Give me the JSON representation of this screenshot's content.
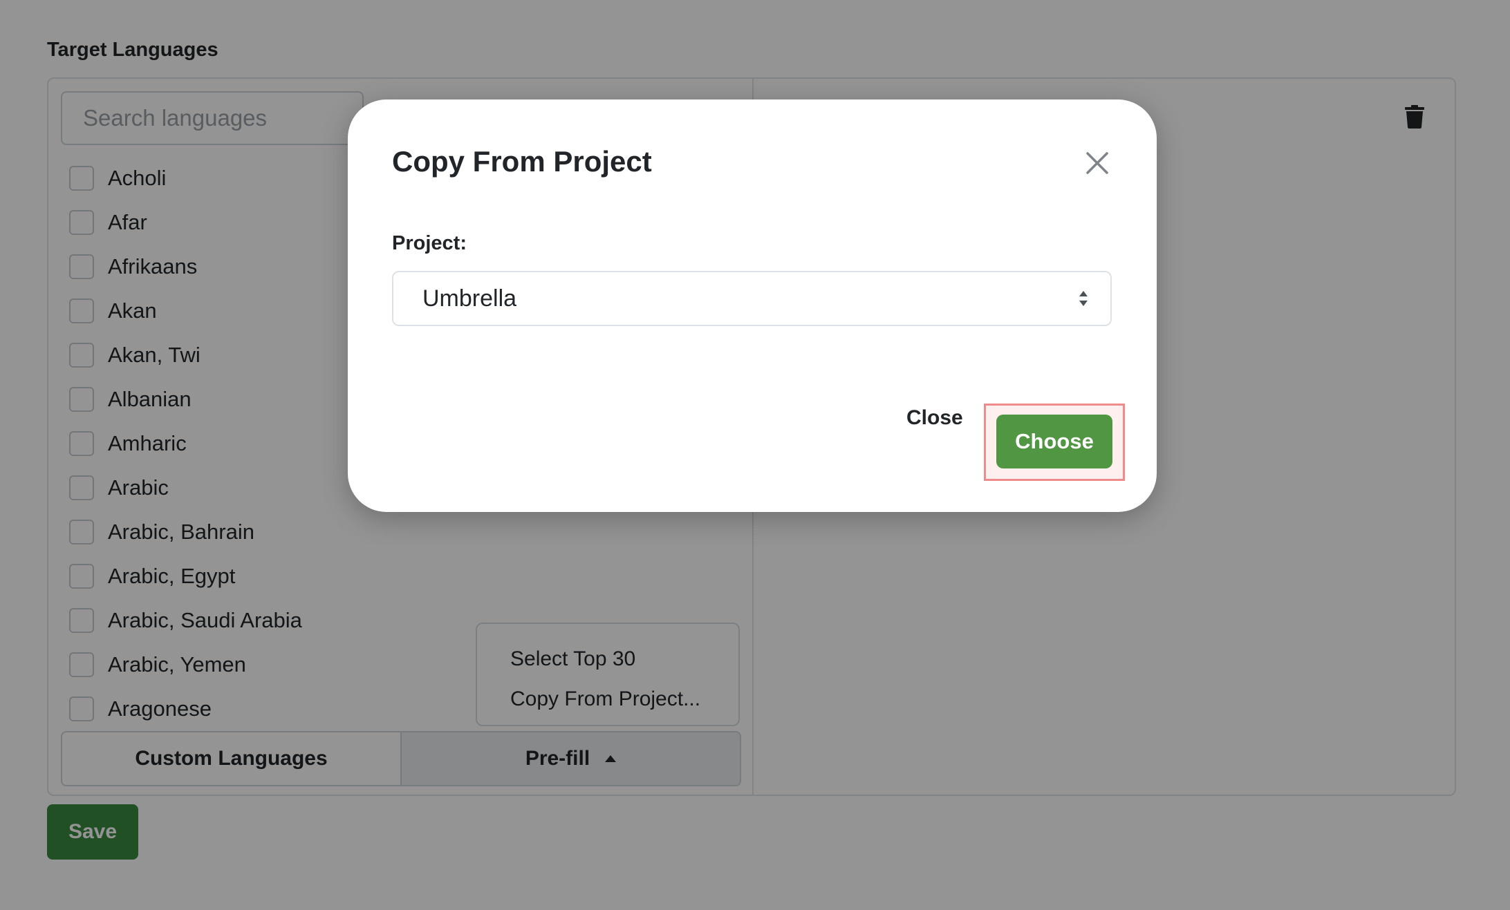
{
  "section": {
    "label": "Target Languages"
  },
  "search": {
    "placeholder": "Search languages",
    "value": ""
  },
  "languages": [
    {
      "label": "Acholi"
    },
    {
      "label": "Afar"
    },
    {
      "label": "Afrikaans"
    },
    {
      "label": "Akan"
    },
    {
      "label": "Akan, Twi"
    },
    {
      "label": "Albanian"
    },
    {
      "label": "Amharic"
    },
    {
      "label": "Arabic"
    },
    {
      "label": "Arabic, Bahrain"
    },
    {
      "label": "Arabic, Egypt"
    },
    {
      "label": "Arabic, Saudi Arabia"
    },
    {
      "label": "Arabic, Yemen"
    },
    {
      "label": "Aragonese"
    }
  ],
  "prefill_menu": {
    "items": [
      {
        "label": "Select Top 30"
      },
      {
        "label": "Copy From Project..."
      }
    ]
  },
  "bottom_buttons": {
    "custom_languages": "Custom Languages",
    "prefill": "Pre-fill"
  },
  "save_label": "Save",
  "modal": {
    "title": "Copy From Project",
    "project_label": "Project:",
    "project_value": "Umbrella",
    "close_label": "Close",
    "choose_label": "Choose"
  },
  "colors": {
    "save_green": "#3a8a3e",
    "choose_green": "#519642",
    "highlight_border": "#f08b8b"
  },
  "icons": {
    "trash": "trash-icon",
    "close": "close-icon",
    "select_arrows": "select-arrows-icon",
    "caret": "caret-up-icon"
  }
}
